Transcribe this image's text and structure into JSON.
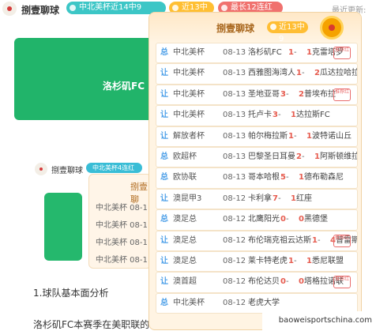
{
  "top": {
    "title": "捌壹聊球",
    "tags": [
      "中北美杯近14中9",
      "近13中9",
      "最长12连红"
    ],
    "update_label": "最近更新:"
  },
  "background": {
    "card_title": "洛杉矶FC",
    "small_title": "捌壹聊球",
    "small_tag": "中北美杯4连红",
    "mini_title": "捌壹聊",
    "mini_rows": [
      "中北美杯 08-1",
      "中北美杯 08-1",
      "中北美杯 08-1",
      "中北美杯 08-1"
    ],
    "article1": "1.球队基本面分析",
    "article2": "洛杉矶FC本赛季在美职联的"
  },
  "popup": {
    "title": "捌壹聊球",
    "tag": "近13中9",
    "badge": "奖章",
    "matches": [
      {
        "mark": "总",
        "league": "中北美杯",
        "date": "08-13",
        "home": "洛杉矶FC",
        "score_h": "1",
        "sep": " - ",
        "score_a": "1",
        "away": "克雷塔罗",
        "badge": "推荐红"
      },
      {
        "mark": "让",
        "league": "中北美杯",
        "date": "08-13",
        "home": "西雅图海湾人",
        "score_h": "1",
        "sep": " - ",
        "score_a": "2",
        "away": "瓜达拉哈拉",
        "badge": ""
      },
      {
        "mark": "让",
        "league": "中北美杯",
        "date": "08-13",
        "home": "圣地亚哥",
        "score_h": "3",
        "sep": " - ",
        "score_a": "2",
        "away": "普埃布拉",
        "badge": "推荐红"
      },
      {
        "mark": "让",
        "league": "中北美杯",
        "date": "08-13",
        "home": "托卢卡",
        "score_h": "3",
        "sep": " - ",
        "score_a": "1",
        "away": "达拉斯FC",
        "badge": ""
      },
      {
        "mark": "让",
        "league": "解放者杯",
        "date": "08-13",
        "home": "帕尔梅拉斯",
        "score_h": "1",
        "sep": " - ",
        "score_a": "1",
        "away": "波特诺山丘",
        "badge": ""
      },
      {
        "mark": "总",
        "league": "欧超杯",
        "date": "08-13",
        "home": "巴黎圣日耳曼",
        "score_h": "2",
        "sep": " - ",
        "score_a": "1",
        "away": "阿斯顿维拉",
        "badge": ""
      },
      {
        "mark": "总",
        "league": "欧协联",
        "date": "08-13",
        "home": "哥本哈根",
        "score_h": "5",
        "sep": " - ",
        "score_a": "1",
        "away": "德布勒森尼",
        "badge": ""
      },
      {
        "mark": "让",
        "league": "澳昆甲3",
        "date": "08-12",
        "home": "卡利拿",
        "score_h": "7",
        "sep": " - ",
        "score_a": "1",
        "away": "红座",
        "badge": ""
      },
      {
        "mark": "总",
        "league": "澳足总",
        "date": "08-12",
        "home": "北鹰阳光",
        "score_h": "0",
        "sep": " - ",
        "score_a": "0",
        "away": "黑德堡",
        "badge": ""
      },
      {
        "mark": "让",
        "league": "澳足总",
        "date": "08-12",
        "home": "布伦瑞克祖云达斯",
        "score_h": "1",
        "sep": " - ",
        "score_a": "4",
        "away": "普雷斯顿莱昂",
        "badge": "推荐红"
      },
      {
        "mark": "让",
        "league": "澳足总",
        "date": "08-12",
        "home": "莱卡特老虎",
        "score_h": "1",
        "sep": " - ",
        "score_a": "1",
        "away": "悉尼联盟",
        "badge": ""
      },
      {
        "mark": "让",
        "league": "澳首超",
        "date": "08-12",
        "home": "布伦达贝",
        "score_h": "0",
        "sep": " - ",
        "score_a": "0",
        "away": "塔格拉诺联",
        "badge": "推荐红"
      },
      {
        "mark": "总",
        "league": "中北美杯",
        "date": "08-12",
        "home": "老虎大学",
        "score_h": "",
        "sep": "",
        "score_a": "",
        "away": "",
        "badge": ""
      }
    ]
  },
  "watermark": "baoweisportschina.com"
}
